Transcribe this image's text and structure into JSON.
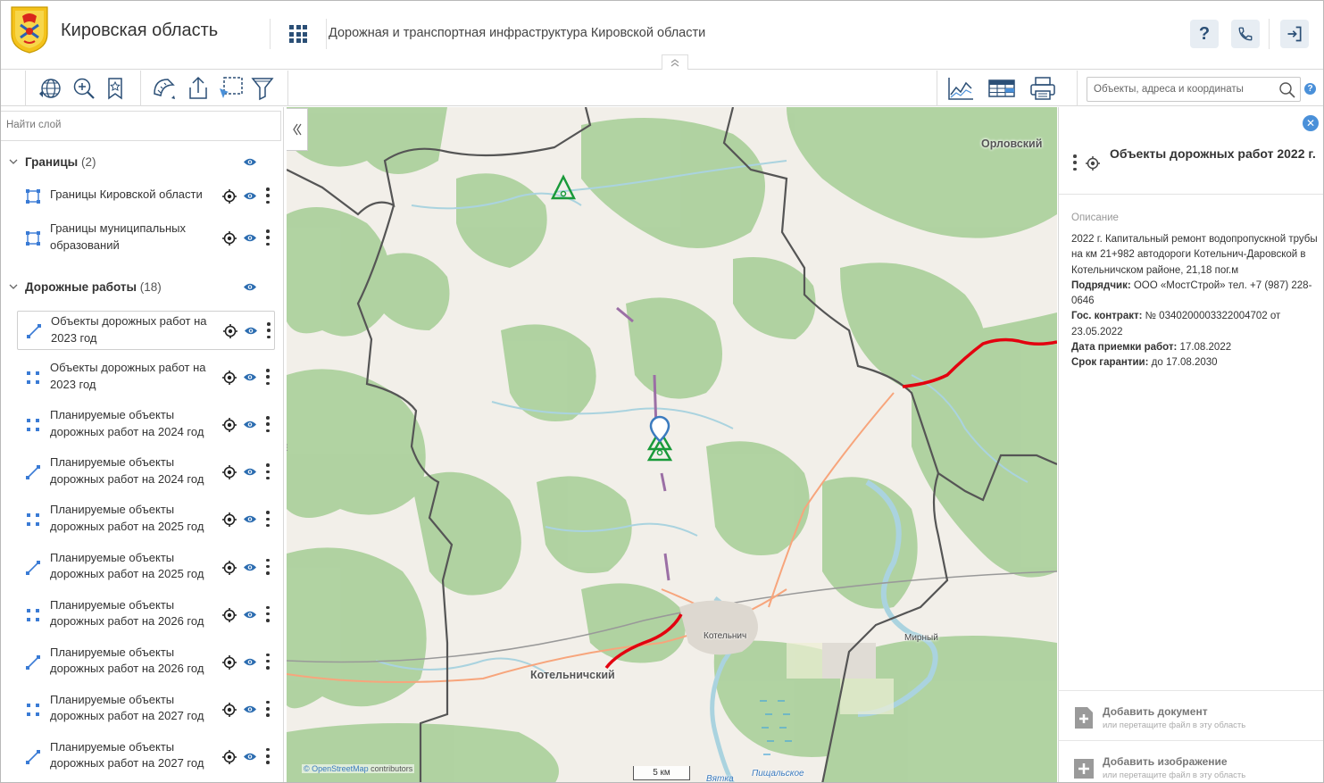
{
  "header": {
    "region_title": "Кировская область",
    "app_title": "Дорожная и транспортная инфраструктура Кировской области",
    "help_label": "?",
    "phone_icon": "phone-icon",
    "login_icon": "login-icon"
  },
  "toolbar": {
    "search_placeholder": "Объекты, адреса и координаты",
    "help_label": "?"
  },
  "left_panel": {
    "search_placeholder": "Найти слой",
    "groups": [
      {
        "name": "Границы",
        "count": "(2)",
        "items": [
          {
            "label": "Границы Кировской области",
            "icon": "polygon-icon"
          },
          {
            "label": "Границы муниципальных образований",
            "icon": "polygon-icon"
          }
        ]
      },
      {
        "name": "Дорожные работы",
        "count": "(18)",
        "items": [
          {
            "label": "Объекты дорожных работ на 2023 год",
            "icon": "line-icon"
          },
          {
            "label": "Объекты дорожных работ на 2023 год",
            "icon": "point-icon"
          },
          {
            "label": "Планируемые объекты дорожных работ на 2024 год",
            "icon": "point-icon"
          },
          {
            "label": "Планируемые объекты дорожных работ на 2024 год",
            "icon": "line-icon"
          },
          {
            "label": "Планируемые объекты дорожных работ на 2025 год",
            "icon": "point-icon"
          },
          {
            "label": "Планируемые объекты дорожных работ на 2025 год",
            "icon": "line-icon"
          },
          {
            "label": "Планируемые объекты дорожных работ на 2026 год",
            "icon": "point-icon"
          },
          {
            "label": "Планируемые объекты дорожных работ на 2026 год",
            "icon": "line-icon"
          },
          {
            "label": "Планируемые объекты дорожных работ на 2027 год",
            "icon": "point-icon"
          },
          {
            "label": "Планируемые объекты дорожных работ на 2027 год",
            "icon": "line-icon"
          }
        ]
      }
    ]
  },
  "map": {
    "labels": {
      "orlovsky": "Орловский",
      "kotelnichsky": "Котельничский",
      "kotelnich": "Котельнич",
      "mirny": "Мирный",
      "pishchalskoe": "Пищальское",
      "vyatka": "Вятка"
    },
    "attribution_link": "© OpenStreetMap",
    "attribution_text": " contributors",
    "scale": "5 км"
  },
  "right_panel": {
    "title": "Объекты дорожных работ 2022 г.",
    "caption": "Описание",
    "description": "2022 г. Капитальный ремонт водопропускной трубы на км 21+982 автодороги Котельнич-Даровской в Котельничском районе, 21,18 пог.м",
    "fields": [
      {
        "label": "Подрядчик:",
        "value": " ООО «МостСтрой» тел. +7 (987) 228-0646"
      },
      {
        "label": "Гос. контракт:",
        "value": " № 0340200003322004702 от 23.05.2022"
      },
      {
        "label": "Дата приемки работ:",
        "value": " 17.08.2022"
      },
      {
        "label": "Срок гарантии:",
        "value": " до 17.08.2030"
      }
    ],
    "add_document": {
      "title": "Добавить документ",
      "hint": "или перетащите файл в эту область"
    },
    "add_image": {
      "title": "Добавить изображение",
      "hint": "или перетащите файл в эту область"
    }
  },
  "colors": {
    "accent": "#2b4f76",
    "link_blue": "#4a90d9",
    "road_red": "#e3000f",
    "object_green": "#1a9a3a",
    "road_purple": "#9b6fa5"
  }
}
